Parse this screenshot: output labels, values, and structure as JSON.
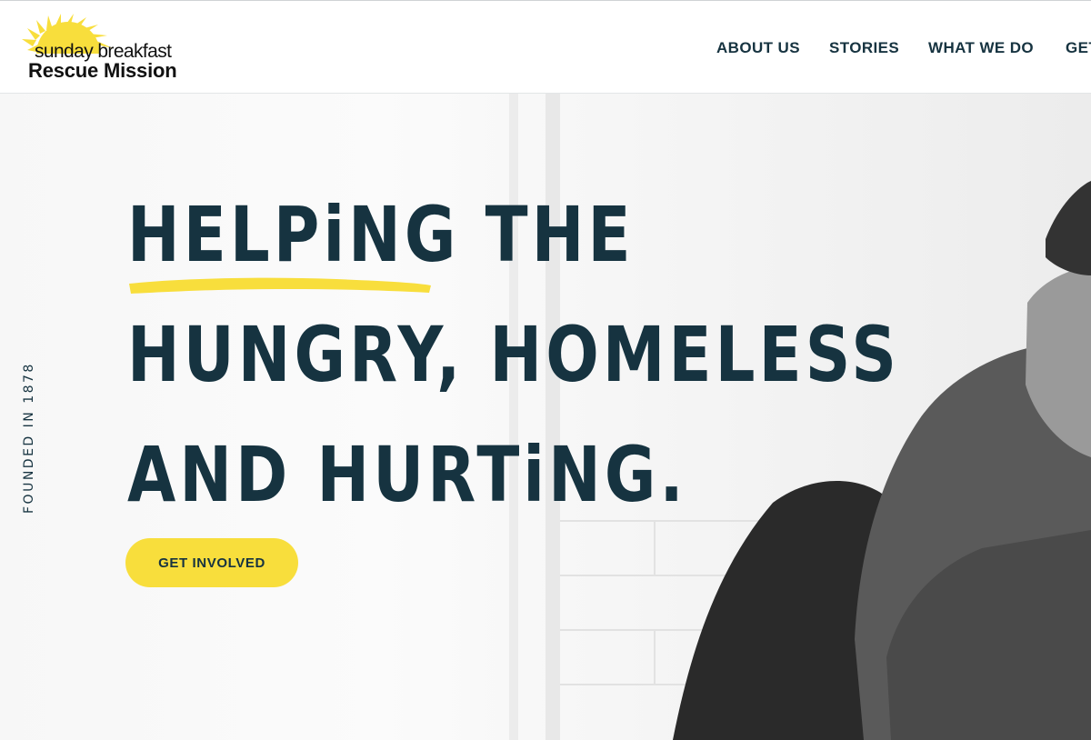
{
  "header": {
    "logo": {
      "line1": "sunday breakfast",
      "line2": "Rescue Mission",
      "sun_color": "#f8de3c"
    },
    "nav": [
      {
        "label": "ABOUT US"
      },
      {
        "label": "STORIES"
      },
      {
        "label": "WHAT WE DO"
      },
      {
        "label": "GET"
      }
    ]
  },
  "hero": {
    "side_text": "FOUNDED IN 1878",
    "headline_lines": [
      "HELPiNG THE",
      "HUNGRY, HOMELESS",
      "AND HURTiNG."
    ],
    "underline_color": "#f8de3c",
    "cta_label": "GET INVOLVED",
    "photo": "man-in-beanie-seated-photo"
  },
  "colors": {
    "navy": "#163340",
    "accent_yellow": "#f8de3c",
    "background": "#ffffff"
  }
}
